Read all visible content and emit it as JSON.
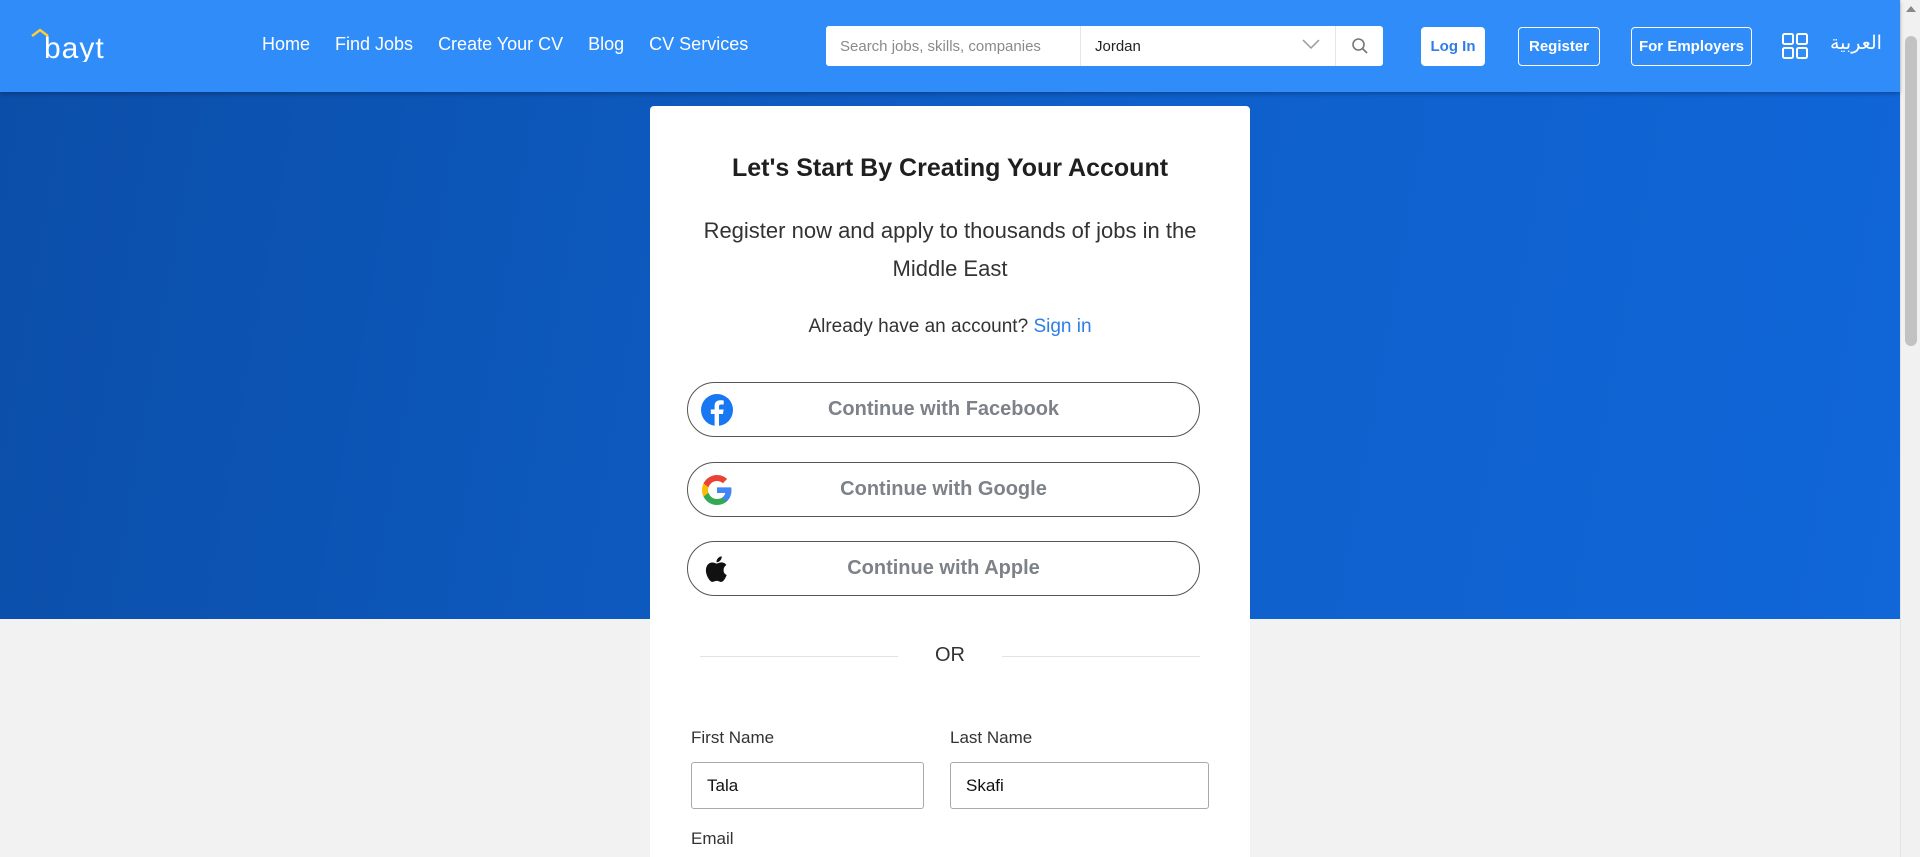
{
  "header": {
    "nav": [
      "Home",
      "Find Jobs",
      "Create Your CV",
      "Blog",
      "CV Services"
    ],
    "search": {
      "placeholder": "Search jobs, skills, companies",
      "location": "Jordan"
    },
    "login_label": "Log In",
    "register_label": "Register",
    "employers_label": "For Employers",
    "language_label": "العربية"
  },
  "card": {
    "title": "Let's Start By Creating Your Account",
    "subtitle": "Register now and apply to thousands of jobs in the Middle East",
    "signin_prompt": "Already have an account?",
    "signin_link": "Sign in",
    "social": {
      "facebook": "Continue with Facebook",
      "google": "Continue with Google",
      "apple": "Continue with Apple"
    },
    "or_label": "OR",
    "form": {
      "first_name_label": "First Name",
      "first_name_value": "Tala",
      "last_name_label": "Last Name",
      "last_name_value": "Skafi",
      "email_label": "Email"
    }
  },
  "colors": {
    "header_blue": "#2f8cf8",
    "hero_blue": "#0e5fc9",
    "link_blue": "#2f7ee6",
    "facebook_blue": "#1877f2"
  },
  "icons": [
    "bayt-logo",
    "chevron-down-icon",
    "search-icon",
    "apps-grid-icon",
    "facebook-icon",
    "google-icon",
    "apple-icon"
  ]
}
